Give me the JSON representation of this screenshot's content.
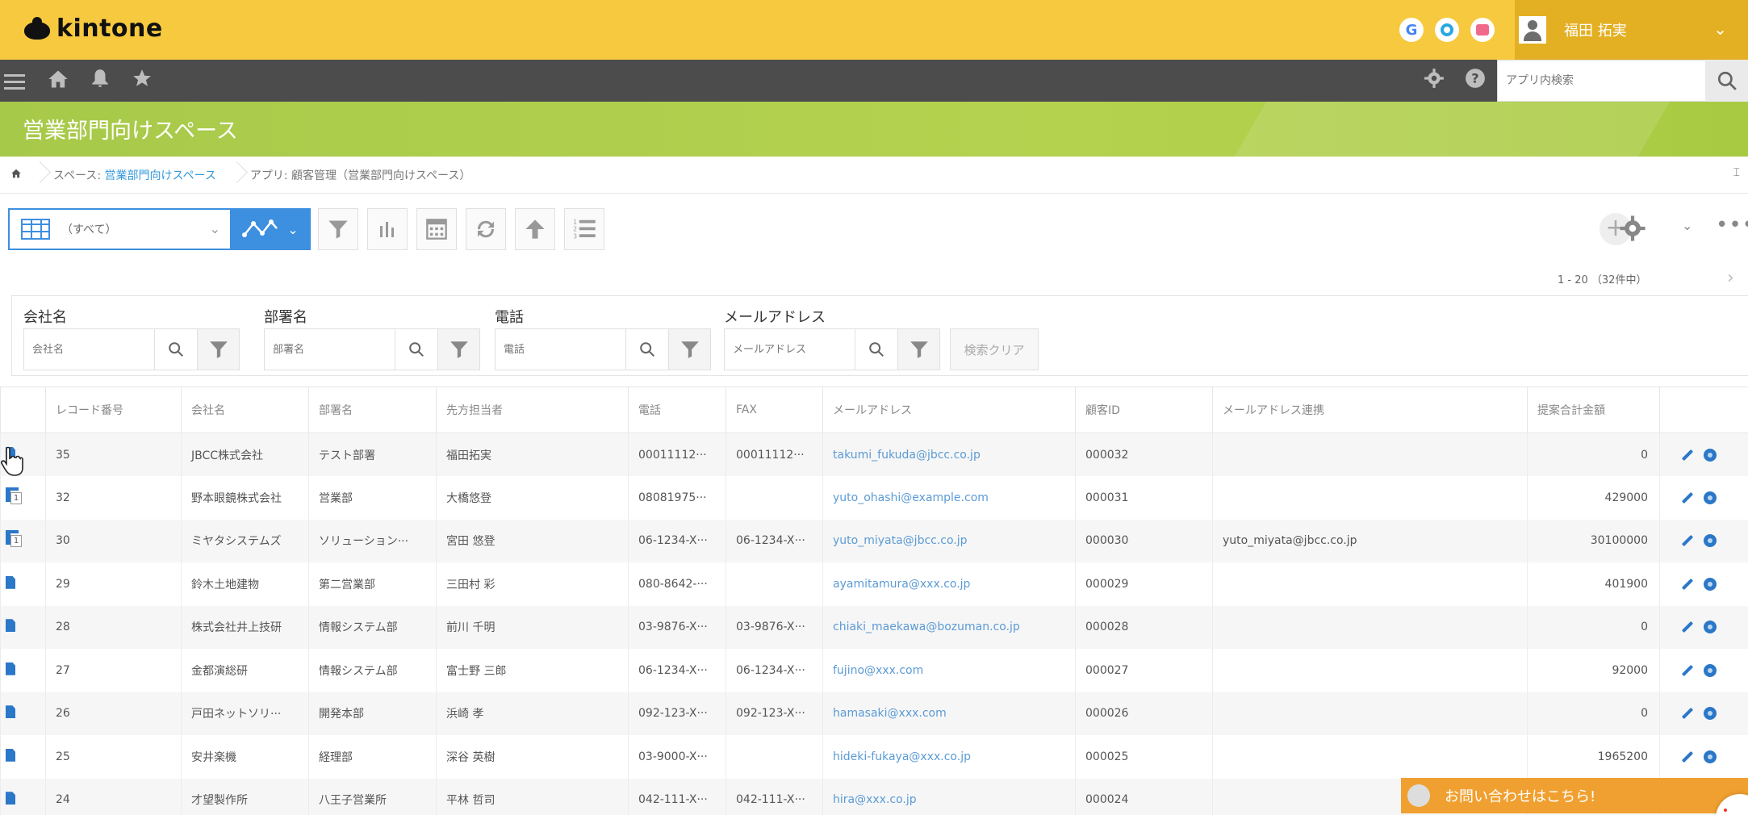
{
  "app": {
    "logo_text": "kintone"
  },
  "header": {
    "user_name": "福田 拓実",
    "apps": [
      "google-icon",
      "garoon-icon",
      "calendar-icon"
    ]
  },
  "nav": {
    "search_placeholder": "アプリ内検索"
  },
  "space": {
    "title": "営業部門向けスペース"
  },
  "breadcrumb": {
    "space_prefix": "スペース: ",
    "space_name": "営業部門向けスペース",
    "app_label": "アプリ: 顧客管理（営業部門向けスペース）",
    "right_mark": "⌶"
  },
  "toolbar": {
    "view_name": "（すべて）"
  },
  "pager": {
    "text": "1 - 20 （32件中）"
  },
  "filters": {
    "company": {
      "label": "会社名",
      "placeholder": "会社名"
    },
    "department": {
      "label": "部署名",
      "placeholder": "部署名"
    },
    "phone": {
      "label": "電話",
      "placeholder": "電話"
    },
    "email": {
      "label": "メールアドレス",
      "placeholder": "メールアドレス"
    },
    "clear_label": "検索クリア"
  },
  "table": {
    "headers": [
      "レコード番号",
      "会社名",
      "部署名",
      "先方担当者",
      "電話",
      "FAX",
      "メールアドレス",
      "顧客ID",
      "メールアドレス連携",
      "提案合計金額"
    ],
    "rows": [
      {
        "icon": "record",
        "no": "35",
        "company": "JBCC株式会社",
        "dept": "テスト部署",
        "contact": "福田拓実",
        "tel": "00011112···",
        "fax": "00011112···",
        "email": "takumi_fukuda@jbcc.co.jp",
        "cid": "000032",
        "mail_link": "",
        "amount": "0"
      },
      {
        "icon": "related",
        "no": "32",
        "company": "野本眼鏡株式会社",
        "dept": "営業部",
        "contact": "大橋悠登",
        "tel": "08081975···",
        "fax": "",
        "email": "yuto_ohashi@example.com",
        "cid": "000031",
        "mail_link": "",
        "amount": "429000"
      },
      {
        "icon": "related",
        "no": "30",
        "company": "ミヤタシステムズ",
        "dept": "ソリューション···",
        "contact": "宮田 悠登",
        "tel": "06-1234-X···",
        "fax": "06-1234-X···",
        "email": "yuto_miyata@jbcc.co.jp",
        "cid": "000030",
        "mail_link": "yuto_miyata@jbcc.co.jp",
        "amount": "30100000"
      },
      {
        "icon": "record",
        "no": "29",
        "company": "鈴木土地建物",
        "dept": "第二営業部",
        "contact": "三田村 彩",
        "tel": "080-8642-···",
        "fax": "",
        "email": "ayamitamura@xxx.co.jp",
        "cid": "000029",
        "mail_link": "",
        "amount": "401900"
      },
      {
        "icon": "record",
        "no": "28",
        "company": "株式会社井上技研",
        "dept": "情報システム部",
        "contact": "前川 千明",
        "tel": "03-9876-X···",
        "fax": "03-9876-X···",
        "email": "chiaki_maekawa@bozuman.co.jp",
        "cid": "000028",
        "mail_link": "",
        "amount": "0"
      },
      {
        "icon": "record",
        "no": "27",
        "company": "金都演総研",
        "dept": "情報システム部",
        "contact": "富士野 三郎",
        "tel": "06-1234-X···",
        "fax": "06-1234-X···",
        "email": "fujino@xxx.com",
        "cid": "000027",
        "mail_link": "",
        "amount": "92000"
      },
      {
        "icon": "record",
        "no": "26",
        "company": "戸田ネットソリ···",
        "dept": "開発本部",
        "contact": "浜崎 孝",
        "tel": "092-123-X···",
        "fax": "092-123-X···",
        "email": "hamasaki@xxx.com",
        "cid": "000026",
        "mail_link": "",
        "amount": "0"
      },
      {
        "icon": "record",
        "no": "25",
        "company": "安井楽機",
        "dept": "経理部",
        "contact": "深谷 英樹",
        "tel": "03-9000-X···",
        "fax": "",
        "email": "hideki-fukaya@xxx.co.jp",
        "cid": "000025",
        "mail_link": "",
        "amount": "1965200"
      },
      {
        "icon": "record",
        "no": "24",
        "company": "才望製作所",
        "dept": "八王子営業所",
        "contact": "平林 哲司",
        "tel": "042-111-X···",
        "fax": "042-111-X···",
        "email": "hira@xxx.co.jp",
        "cid": "000024",
        "mail_link": "",
        "amount": ""
      }
    ]
  },
  "contact_banner": {
    "text": "お問い合わせはこちら!"
  }
}
